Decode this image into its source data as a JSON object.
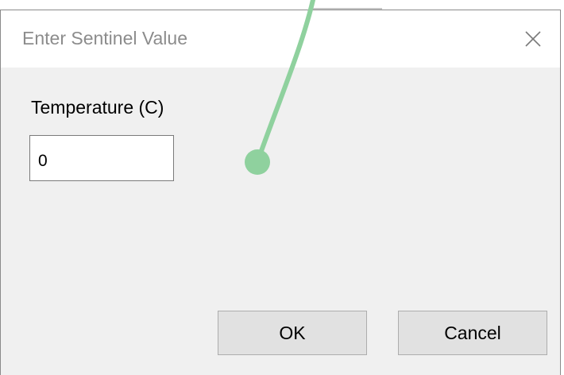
{
  "dialog": {
    "title": "Enter Sentinel Value",
    "close_icon": "close-icon"
  },
  "form": {
    "label": "Temperature (C)",
    "value": "0"
  },
  "buttons": {
    "ok_label": "OK",
    "cancel_label": "Cancel"
  },
  "overlay": {
    "drag_trail_color": "#8fd19e",
    "drag_trail_icon": "drag-cursor-trail"
  }
}
